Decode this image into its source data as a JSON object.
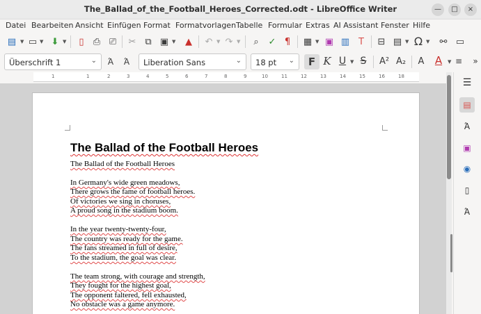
{
  "window": {
    "title": "The_Ballad_of_the_Football_Heroes_Corrected.odt - LibreOffice Writer",
    "minimize": "—",
    "maximize": "□",
    "close": "×"
  },
  "menu": [
    "Datei",
    "Bearbeiten",
    "Ansicht",
    "Einfügen",
    "Format",
    "Formatvorlagen",
    "Tabelle",
    "Formular",
    "Extras",
    "AI Assistant",
    "Fenster",
    "Hilfe"
  ],
  "formatting": {
    "paragraph_style": "Überschrift 1",
    "font_name": "Liberation Sans",
    "font_size": "18 pt"
  },
  "ruler": [
    "1",
    "1",
    "2",
    "3",
    "4",
    "5",
    "6",
    "7",
    "8",
    "9",
    "10",
    "11",
    "12",
    "13",
    "14",
    "15",
    "16",
    "18"
  ],
  "document": {
    "heading": "The Ballad of the Football Heroes",
    "lines": [
      "The Ballad of the Football Heroes",
      "In Germany's wide green meadows,",
      "There grows the fame of football heroes.",
      "Of victories we sing in choruses,",
      "A proud song in the stadium boom.",
      "In the year twenty-twenty-four,",
      "The country was ready for the game.",
      "The fans streamed in full of desire,",
      "To the stadium, the goal was clear.",
      "The team strong, with courage and strength,",
      "They fought for the highest goal,",
      "The opponent faltered, fell exhausted,",
      "No obstacle was a game anymore."
    ]
  },
  "icons": {
    "toolbar": [
      "new-document",
      "open-folder",
      "save-download",
      "export-pdf",
      "print",
      "print-preview",
      "cut",
      "copy",
      "paste",
      "clone-formatting",
      "undo",
      "redo",
      "find-replace",
      "spellcheck",
      "formatting-marks",
      "insert-table",
      "insert-image",
      "insert-chart",
      "insert-textbox",
      "page-break",
      "insert-field",
      "special-character",
      "hyperlink",
      "comment"
    ],
    "format": [
      "update-style",
      "new-style",
      "bold",
      "italic",
      "underline",
      "strikethrough",
      "superscript",
      "subscript",
      "clear-formatting",
      "font-color",
      "align"
    ],
    "sidebar": [
      "menu",
      "properties",
      "styles",
      "gallery",
      "navigator",
      "page",
      "style-inspector"
    ]
  },
  "colors": {
    "accent_red": "#c9302c",
    "spell_underline": "#e04a4a"
  }
}
